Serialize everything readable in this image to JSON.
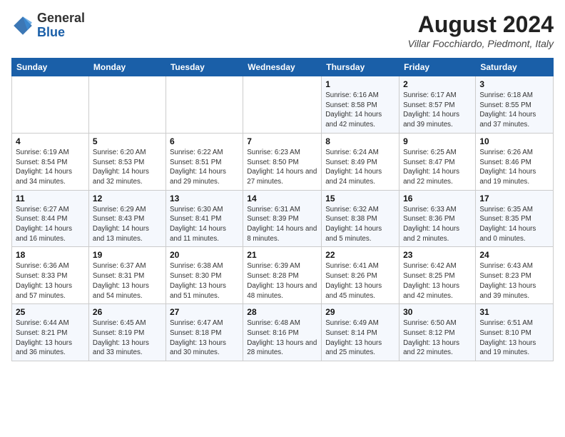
{
  "header": {
    "logo_general": "General",
    "logo_blue": "Blue",
    "month_year": "August 2024",
    "location": "Villar Focchiardo, Piedmont, Italy"
  },
  "weekdays": [
    "Sunday",
    "Monday",
    "Tuesday",
    "Wednesday",
    "Thursday",
    "Friday",
    "Saturday"
  ],
  "weeks": [
    [
      {
        "day": "",
        "info": ""
      },
      {
        "day": "",
        "info": ""
      },
      {
        "day": "",
        "info": ""
      },
      {
        "day": "",
        "info": ""
      },
      {
        "day": "1",
        "info": "Sunrise: 6:16 AM\nSunset: 8:58 PM\nDaylight: 14 hours and 42 minutes."
      },
      {
        "day": "2",
        "info": "Sunrise: 6:17 AM\nSunset: 8:57 PM\nDaylight: 14 hours and 39 minutes."
      },
      {
        "day": "3",
        "info": "Sunrise: 6:18 AM\nSunset: 8:55 PM\nDaylight: 14 hours and 37 minutes."
      }
    ],
    [
      {
        "day": "4",
        "info": "Sunrise: 6:19 AM\nSunset: 8:54 PM\nDaylight: 14 hours and 34 minutes."
      },
      {
        "day": "5",
        "info": "Sunrise: 6:20 AM\nSunset: 8:53 PM\nDaylight: 14 hours and 32 minutes."
      },
      {
        "day": "6",
        "info": "Sunrise: 6:22 AM\nSunset: 8:51 PM\nDaylight: 14 hours and 29 minutes."
      },
      {
        "day": "7",
        "info": "Sunrise: 6:23 AM\nSunset: 8:50 PM\nDaylight: 14 hours and 27 minutes."
      },
      {
        "day": "8",
        "info": "Sunrise: 6:24 AM\nSunset: 8:49 PM\nDaylight: 14 hours and 24 minutes."
      },
      {
        "day": "9",
        "info": "Sunrise: 6:25 AM\nSunset: 8:47 PM\nDaylight: 14 hours and 22 minutes."
      },
      {
        "day": "10",
        "info": "Sunrise: 6:26 AM\nSunset: 8:46 PM\nDaylight: 14 hours and 19 minutes."
      }
    ],
    [
      {
        "day": "11",
        "info": "Sunrise: 6:27 AM\nSunset: 8:44 PM\nDaylight: 14 hours and 16 minutes."
      },
      {
        "day": "12",
        "info": "Sunrise: 6:29 AM\nSunset: 8:43 PM\nDaylight: 14 hours and 13 minutes."
      },
      {
        "day": "13",
        "info": "Sunrise: 6:30 AM\nSunset: 8:41 PM\nDaylight: 14 hours and 11 minutes."
      },
      {
        "day": "14",
        "info": "Sunrise: 6:31 AM\nSunset: 8:39 PM\nDaylight: 14 hours and 8 minutes."
      },
      {
        "day": "15",
        "info": "Sunrise: 6:32 AM\nSunset: 8:38 PM\nDaylight: 14 hours and 5 minutes."
      },
      {
        "day": "16",
        "info": "Sunrise: 6:33 AM\nSunset: 8:36 PM\nDaylight: 14 hours and 2 minutes."
      },
      {
        "day": "17",
        "info": "Sunrise: 6:35 AM\nSunset: 8:35 PM\nDaylight: 14 hours and 0 minutes."
      }
    ],
    [
      {
        "day": "18",
        "info": "Sunrise: 6:36 AM\nSunset: 8:33 PM\nDaylight: 13 hours and 57 minutes."
      },
      {
        "day": "19",
        "info": "Sunrise: 6:37 AM\nSunset: 8:31 PM\nDaylight: 13 hours and 54 minutes."
      },
      {
        "day": "20",
        "info": "Sunrise: 6:38 AM\nSunset: 8:30 PM\nDaylight: 13 hours and 51 minutes."
      },
      {
        "day": "21",
        "info": "Sunrise: 6:39 AM\nSunset: 8:28 PM\nDaylight: 13 hours and 48 minutes."
      },
      {
        "day": "22",
        "info": "Sunrise: 6:41 AM\nSunset: 8:26 PM\nDaylight: 13 hours and 45 minutes."
      },
      {
        "day": "23",
        "info": "Sunrise: 6:42 AM\nSunset: 8:25 PM\nDaylight: 13 hours and 42 minutes."
      },
      {
        "day": "24",
        "info": "Sunrise: 6:43 AM\nSunset: 8:23 PM\nDaylight: 13 hours and 39 minutes."
      }
    ],
    [
      {
        "day": "25",
        "info": "Sunrise: 6:44 AM\nSunset: 8:21 PM\nDaylight: 13 hours and 36 minutes."
      },
      {
        "day": "26",
        "info": "Sunrise: 6:45 AM\nSunset: 8:19 PM\nDaylight: 13 hours and 33 minutes."
      },
      {
        "day": "27",
        "info": "Sunrise: 6:47 AM\nSunset: 8:18 PM\nDaylight: 13 hours and 30 minutes."
      },
      {
        "day": "28",
        "info": "Sunrise: 6:48 AM\nSunset: 8:16 PM\nDaylight: 13 hours and 28 minutes."
      },
      {
        "day": "29",
        "info": "Sunrise: 6:49 AM\nSunset: 8:14 PM\nDaylight: 13 hours and 25 minutes."
      },
      {
        "day": "30",
        "info": "Sunrise: 6:50 AM\nSunset: 8:12 PM\nDaylight: 13 hours and 22 minutes."
      },
      {
        "day": "31",
        "info": "Sunrise: 6:51 AM\nSunset: 8:10 PM\nDaylight: 13 hours and 19 minutes."
      }
    ]
  ]
}
